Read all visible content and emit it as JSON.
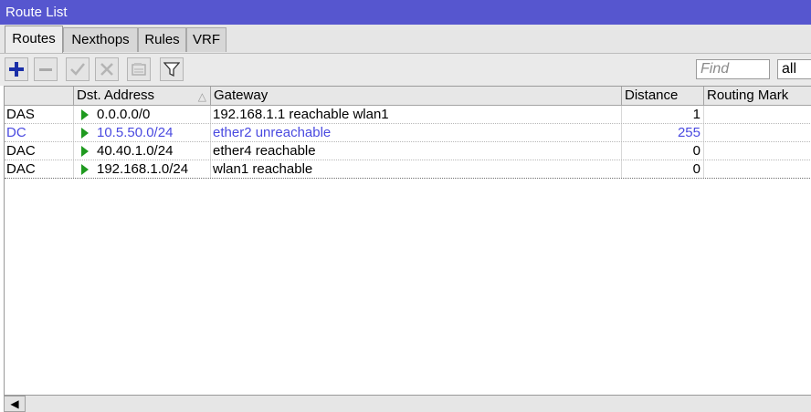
{
  "window": {
    "title": "Route List"
  },
  "tabs": [
    {
      "label": "Routes",
      "active": true
    },
    {
      "label": "Nexthops",
      "active": false
    },
    {
      "label": "Rules",
      "active": false
    },
    {
      "label": "VRF",
      "active": false
    }
  ],
  "toolbar": {
    "buttons": [
      {
        "name": "add-button",
        "icon": "plus-icon"
      },
      {
        "name": "remove-button",
        "icon": "minus-icon"
      },
      {
        "name": "enable-button",
        "icon": "check-icon"
      },
      {
        "name": "disable-button",
        "icon": "x-icon"
      },
      {
        "name": "comment-button",
        "icon": "note-icon"
      },
      {
        "name": "filter-button",
        "icon": "filter-icon"
      }
    ],
    "find_placeholder": "Find",
    "filter_value": "all"
  },
  "table": {
    "columns": [
      {
        "key": "flags",
        "label": ""
      },
      {
        "key": "dst",
        "label": "Dst. Address"
      },
      {
        "key": "gateway",
        "label": "Gateway"
      },
      {
        "key": "distance",
        "label": "Distance"
      },
      {
        "key": "mark",
        "label": "Routing Mark"
      }
    ],
    "rows": [
      {
        "flags": "DAS",
        "dst": "0.0.0.0/0",
        "gateway": "192.168.1.1 reachable wlan1",
        "distance": "1",
        "mark": "",
        "inactive": false
      },
      {
        "flags": "DC",
        "dst": "10.5.50.0/24",
        "gateway": "ether2 unreachable",
        "distance": "255",
        "mark": "",
        "inactive": true
      },
      {
        "flags": "DAC",
        "dst": "40.40.1.0/24",
        "gateway": "ether4 reachable",
        "distance": "0",
        "mark": "",
        "inactive": false
      },
      {
        "flags": "DAC",
        "dst": "192.168.1.0/24",
        "gateway": "wlan1 reachable",
        "distance": "0",
        "mark": "",
        "inactive": false
      }
    ]
  },
  "colors": {
    "titlebar": "#5656cf",
    "inactive_text": "#4a4ae0",
    "active_marker": "#1f9a1f"
  }
}
